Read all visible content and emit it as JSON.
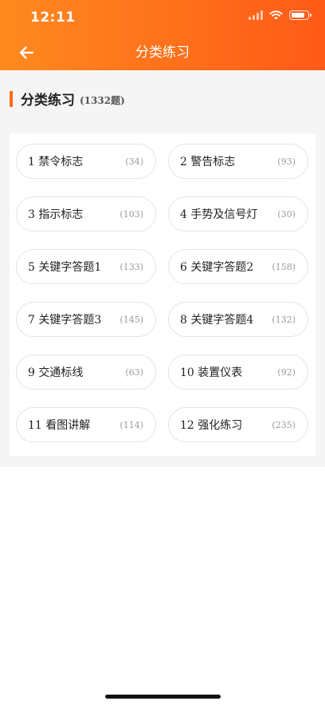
{
  "status_bar": {
    "time": "12:11",
    "battery_level": 0.85
  },
  "nav": {
    "title": "分类练习",
    "back_icon": "arrow-left-icon"
  },
  "section": {
    "title": "分类练习",
    "count": "(1332题)"
  },
  "categories": [
    {
      "name": "1 禁令标志",
      "count": "(34)"
    },
    {
      "name": "2 警告标志",
      "count": "(93)"
    },
    {
      "name": "3 指示标志",
      "count": "(103)"
    },
    {
      "name": "4 手势及信号灯",
      "count": "(30)"
    },
    {
      "name": "5 关键字答题1",
      "count": "(133)"
    },
    {
      "name": "6 关键字答题2",
      "count": "(158)"
    },
    {
      "name": "7 关键字答题3",
      "count": "(145)"
    },
    {
      "name": "8 关键字答题4",
      "count": "(132)"
    },
    {
      "name": "9 交通标线",
      "count": "(63)"
    },
    {
      "name": "10 装置仪表",
      "count": "(92)"
    },
    {
      "name": "11 看图讲解",
      "count": "(114)"
    },
    {
      "name": "12 强化练习",
      "count": "(235)"
    }
  ],
  "colors": {
    "header_start": "#ff8a1f",
    "header_end": "#ff5a17",
    "accent": "#ff6a1a"
  }
}
